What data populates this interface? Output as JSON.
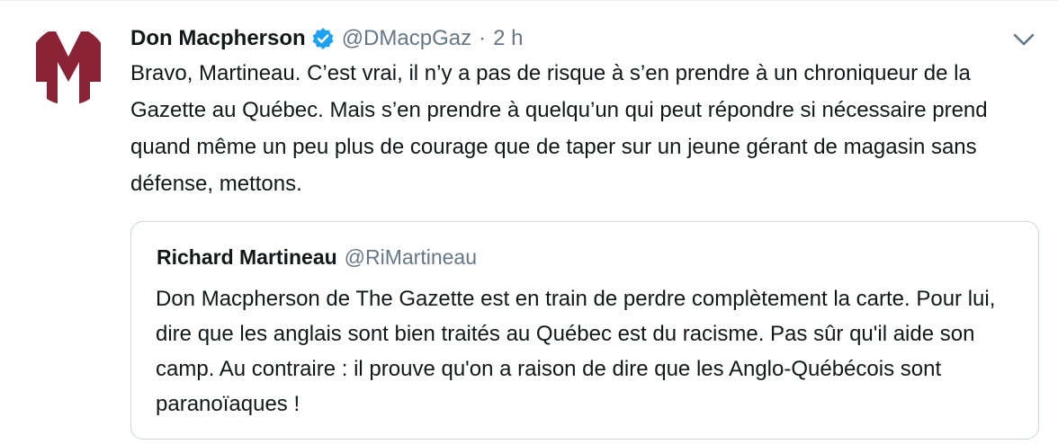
{
  "tweet": {
    "author_name": "Don Macpherson",
    "author_handle": "@DMacpGaz",
    "separator": "·",
    "time": "2 h",
    "text": "Bravo, Martineau. C’est vrai, il n’y a pas de risque à s’en prendre à un chroniqueur de la Gazette au Québec. Mais s’en prendre à quelqu’un qui peut répondre si nécessaire prend quand même un peu plus de courage que de taper sur un jeune gérant de magasin sans défense, mettons.",
    "avatar_letter": "M",
    "verified_icon": "verified-badge-icon",
    "menu_icon": "chevron-down-icon"
  },
  "quoted_tweet": {
    "author_name": "Richard Martineau",
    "author_handle": "@RiMartineau",
    "text": "Don Macpherson de The Gazette est en train de perdre complètement la carte. Pour lui, dire que les anglais sont bien traités au Québec est du racisme. Pas sûr qu'il aide son camp. Au contraire : il prouve qu'on a raison de dire que les Anglo-Québécois sont paranoïaques !"
  },
  "colors": {
    "avatar_maroon": "#8b2336",
    "verified_blue": "#1da1f2",
    "secondary_text": "#657786",
    "border": "#ccd6dd"
  }
}
